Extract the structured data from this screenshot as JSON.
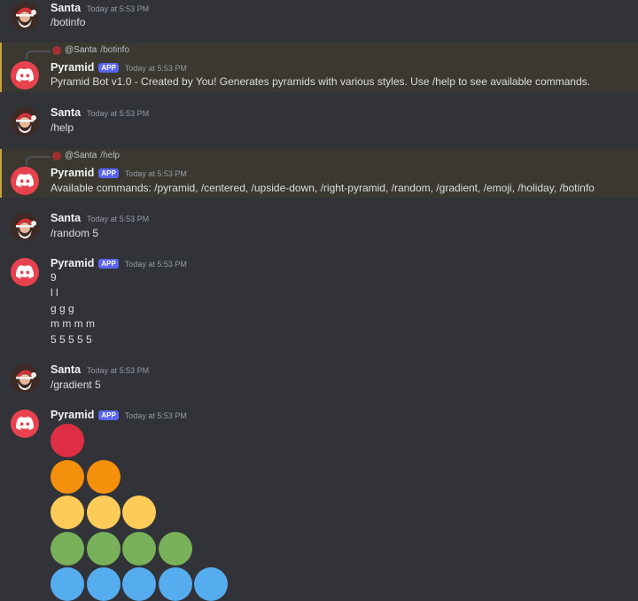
{
  "colors": {
    "background": "#313338",
    "highlight": "#3a3830",
    "app_badge": "#5865f2",
    "bot_avatar": "#e8424e",
    "red": "#dd2e44",
    "orange": "#f4900c",
    "yellow": "#fdcb58",
    "green": "#78b159",
    "blue": "#55acee"
  },
  "messages": [
    {
      "author": "Santa",
      "time": "Today at 5:53 PM",
      "text": "/botinfo"
    },
    {
      "author": "Pyramid",
      "badge": "APP",
      "time": "Today at 5:53 PM",
      "reply": {
        "user": "@Santa",
        "command": "/botinfo"
      },
      "text": "Pyramid Bot v1.0 - Created by You! Generates pyramids with various styles. Use /help to see available commands."
    },
    {
      "author": "Santa",
      "time": "Today at 5:53 PM",
      "text": "/help"
    },
    {
      "author": "Pyramid",
      "badge": "APP",
      "time": "Today at 5:53 PM",
      "reply": {
        "user": "@Santa",
        "command": "/help"
      },
      "text": "Available commands: /pyramid, /centered, /upside-down, /right-pyramid, /random, /gradient, /emoji, /holiday, /botinfo"
    },
    {
      "author": "Santa",
      "time": "Today at 5:53 PM",
      "text": "/random 5"
    },
    {
      "author": "Pyramid",
      "badge": "APP",
      "time": "Today at 5:53 PM",
      "lines": [
        "9",
        "l l",
        "g g g",
        "m m m m",
        "5 5 5 5 5"
      ]
    },
    {
      "author": "Santa",
      "time": "Today at 5:53 PM",
      "text": "/gradient 5"
    },
    {
      "author": "Pyramid",
      "badge": "APP",
      "time": "Today at 5:53 PM",
      "gradient_rows": [
        "red",
        "orange",
        "yellow",
        "green",
        "blue"
      ]
    }
  ]
}
